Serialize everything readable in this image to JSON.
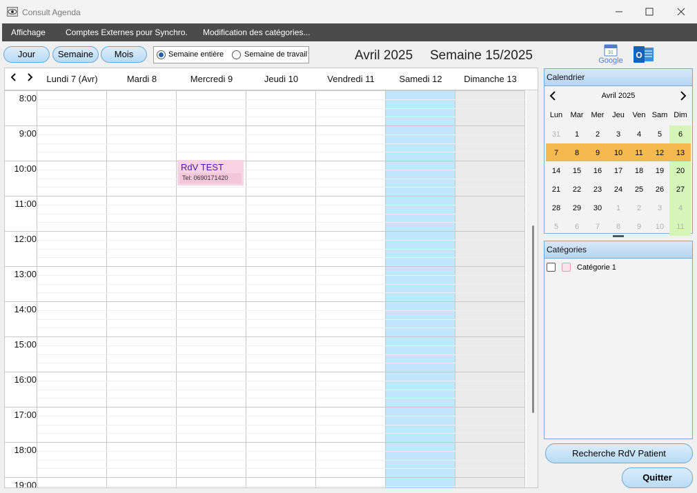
{
  "window": {
    "title": "Consult Agenda"
  },
  "menu": [
    "Affichage",
    "Comptes Externes pour Synchro.",
    "Modification des catégories..."
  ],
  "view_buttons": {
    "day": "Jour",
    "week": "Semaine",
    "month": "Mois"
  },
  "week_mode": {
    "full": "Semaine entière",
    "work": "Semaine de travail",
    "selected": "full"
  },
  "header": {
    "month": "Avril 2025",
    "week": "Semaine 15/2025"
  },
  "sync_icons": {
    "google_day": "31",
    "google_label": "Google",
    "outlook_letter": "O"
  },
  "days": [
    "Lundi 7 (Avr)",
    "Mardi 8",
    "Mercredi 9",
    "Jeudi 10",
    "Vendredi 11",
    "Samedi 12",
    "Dimanche 13"
  ],
  "hours": [
    "8:00",
    "9:00",
    "10:00",
    "11:00",
    "12:00",
    "13:00",
    "14:00",
    "15:00",
    "16:00",
    "17:00",
    "18:00",
    "19:00"
  ],
  "events": [
    {
      "title": "RdV TEST",
      "tel": "Tel: 0690171420",
      "day": "Mercredi 9",
      "start": "10:00"
    }
  ],
  "mini_calendar": {
    "title": "Calendrier",
    "month": "Avril 2025",
    "dow": [
      "Lun",
      "Mar",
      "Mer",
      "Jeu",
      "Ven",
      "Sam",
      "Dim"
    ],
    "weeks": [
      [
        "31",
        "1",
        "2",
        "3",
        "4",
        "5",
        "6"
      ],
      [
        "7",
        "8",
        "9",
        "10",
        "11",
        "12",
        "13"
      ],
      [
        "14",
        "15",
        "16",
        "17",
        "18",
        "19",
        "20"
      ],
      [
        "21",
        "22",
        "23",
        "24",
        "25",
        "26",
        "27"
      ],
      [
        "28",
        "29",
        "30",
        "1",
        "2",
        "3",
        "4"
      ],
      [
        "5",
        "6",
        "7",
        "8",
        "9",
        "10",
        "11"
      ]
    ]
  },
  "categories": {
    "title": "Catégories",
    "items": [
      {
        "label": "Catégorie 1",
        "checked": false,
        "color": "#fbe3ec"
      }
    ]
  },
  "buttons": {
    "search": "Recherche RdV Patient",
    "quit": "Quitter"
  },
  "colors": {
    "accent": "#b8dbf6",
    "saturday": "#bfe6fb",
    "sunday": "#ebebeb",
    "event": "#f8d3e2",
    "selected_week": "#f5ba4f",
    "mini_sunday": "#d6f5b9"
  }
}
